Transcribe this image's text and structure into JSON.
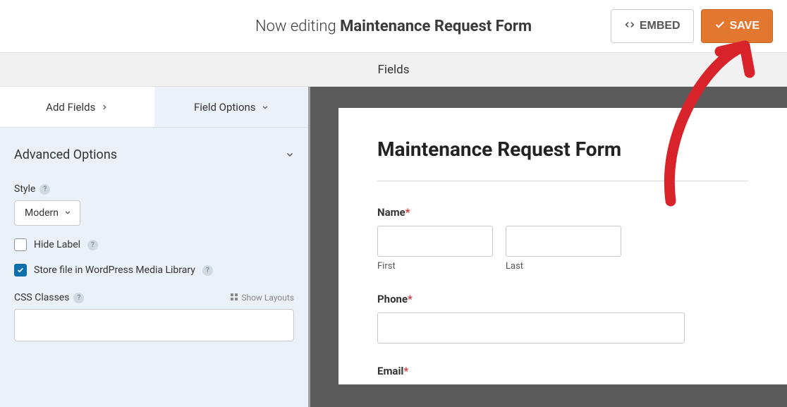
{
  "header": {
    "editing_prefix": "Now editing ",
    "form_name": "Maintenance Request Form",
    "embed_label": "EMBED",
    "save_label": "SAVE"
  },
  "fields_header": "Fields",
  "tabs": {
    "add_fields": "Add Fields",
    "field_options": "Field Options"
  },
  "advanced_options_label": "Advanced Options",
  "style": {
    "label": "Style",
    "value": "Modern"
  },
  "hide_label": "Hide Label",
  "store_file": "Store file in WordPress Media Library",
  "css_classes_label": "CSS Classes",
  "show_layouts": "Show Layouts",
  "css_classes_value": "",
  "form": {
    "title": "Maintenance Request Form",
    "name_label": "Name",
    "phone_label": "Phone",
    "email_label": "Email",
    "first": "First",
    "last": "Last",
    "required_marker": "*"
  }
}
